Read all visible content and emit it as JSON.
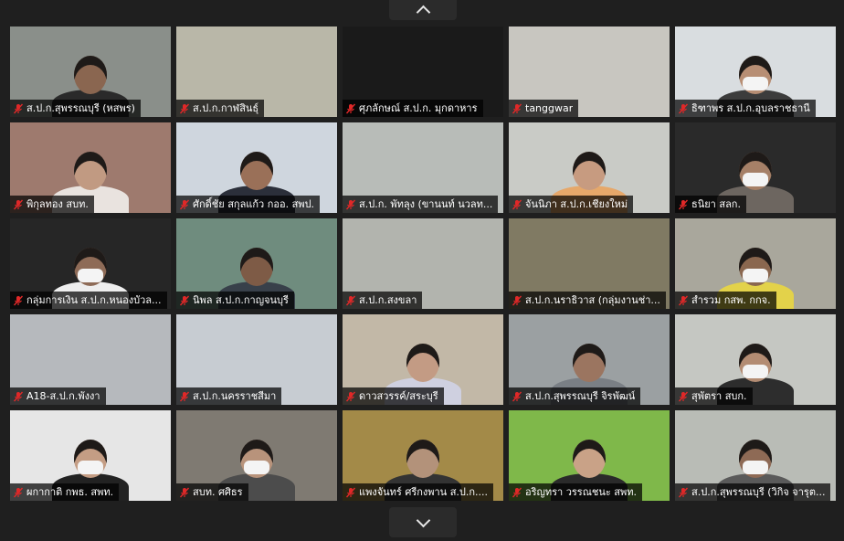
{
  "nav": {
    "up_icon": "chevron-up-icon",
    "down_icon": "chevron-down-icon"
  },
  "tiles": [
    {
      "name": "ส.ป.ก.สุพรรณบุรี (หสพร)",
      "bg": "#8a8f8a",
      "person": true,
      "skin": "#8a6650",
      "shirt": "#2a2a2a",
      "mask": false
    },
    {
      "name": "ส.ป.ก.กาฬสินธุ์",
      "bg": "#b9b7a8",
      "person": false
    },
    {
      "name": "ศุภลักษณ์ ส.ป.ก. มุกดาหาร",
      "bg": "#1a1a1a",
      "person": false
    },
    {
      "name": "tanggwar",
      "bg": "#c8c6c0",
      "person": false
    },
    {
      "name": "ธิฑาพร ส.ป.ก.อุบลราชธานี",
      "bg": "#d9dde0",
      "person": true,
      "skin": "#b78e74",
      "shirt": "#3c3c3c",
      "mask": true
    },
    {
      "name": "พิกุลทอง สบท.",
      "bg": "#9e7a6e",
      "person": true,
      "skin": "#c19a82",
      "shirt": "#e9e3df",
      "mask": false
    },
    {
      "name": "ศักดิ์ชัย สกุลแก้ว กออ. สพป.",
      "bg": "#cfd6de",
      "person": true,
      "skin": "#9a7058",
      "shirt": "#2b2f3a",
      "mask": false
    },
    {
      "name": "ส.ป.ก. พัทลุง (ขานนท์ นวลท...",
      "bg": "#b8bcb8",
      "person": false
    },
    {
      "name": "จันนิภา ส.ป.ก.เชียงใหม่",
      "bg": "#c9cbc6",
      "person": true,
      "skin": "#c79b80",
      "shirt": "#e6a86a",
      "mask": false
    },
    {
      "name": "ธนิยา สลก.",
      "bg": "#2a2a2a",
      "person": true,
      "skin": "#a68067",
      "shirt": "#6d6660",
      "mask": true
    },
    {
      "name": "กลุ่มการเงิน ส.ป.ก.หนองบัวล...",
      "bg": "#262626",
      "person": true,
      "skin": "#8e6b57",
      "shirt": "#eeeeee",
      "mask": true
    },
    {
      "name": "นิพล ส.ป.ก.กาญจนบุรี",
      "bg": "#6f8c7e",
      "person": true,
      "skin": "#7e5b46",
      "shirt": "#38404a",
      "mask": false
    },
    {
      "name": "ส.ป.ก.สงขลา",
      "bg": "#b2b4ae",
      "person": false
    },
    {
      "name": "ส.ป.ก.นราธิวาส (กลุ่มงานช่า...",
      "bg": "#807a63",
      "person": false
    },
    {
      "name": "สำรวม กสพ. กกจ.",
      "bg": "#a9a79c",
      "person": true,
      "skin": "#8a674f",
      "shirt": "#e3d24a",
      "mask": true
    },
    {
      "name": "A18-ส.ป.ก.พังงา",
      "bg": "#b6b9bd",
      "person": false
    },
    {
      "name": "ส.ป.ก.นครราชสีมา",
      "bg": "#c7ccd2",
      "person": false
    },
    {
      "name": "ดาวสวรรค์/สระบุรี",
      "bg": "#c2b8a7",
      "person": true,
      "skin": "#c39b84",
      "shirt": "#cfd0e0",
      "mask": false
    },
    {
      "name": "ส.ป.ก.สุพรรณบุรี จิรพัฒน์",
      "bg": "#9ba0a2",
      "person": true,
      "skin": "#9b7560",
      "shirt": "#7a7f85",
      "mask": false
    },
    {
      "name": "สุพัตรา สบก.",
      "bg": "#c5c7c2",
      "person": true,
      "skin": "#b38c73",
      "shirt": "#2d2d2d",
      "mask": true
    },
    {
      "name": "ผกากาติ กพธ. สพท.",
      "bg": "#e6e6e6",
      "person": true,
      "skin": "#c49d84",
      "shirt": "#222222",
      "mask": true
    },
    {
      "name": "สบท. ศศิธร",
      "bg": "#7f7a72",
      "person": true,
      "skin": "#b8937b",
      "shirt": "#4c4c4c",
      "mask": true
    },
    {
      "name": "แพงจันทร์ ศรีกงพาน ส.ป.ก....",
      "bg": "#a38a48",
      "person": true,
      "skin": "#b3927a",
      "shirt": "#333333",
      "mask": false
    },
    {
      "name": "อริญทรา วรรณชนะ สพท.",
      "bg": "#7fb84a",
      "person": true,
      "skin": "#c9a287",
      "shirt": "#2a2a2a",
      "mask": false
    },
    {
      "name": "ส.ป.ก.สุพรรณบุรี (วิกิจ จารุต...",
      "bg": "#b9bcb6",
      "person": true,
      "skin": "#8e6a55",
      "shirt": "#5a5a5a",
      "mask": true
    }
  ]
}
